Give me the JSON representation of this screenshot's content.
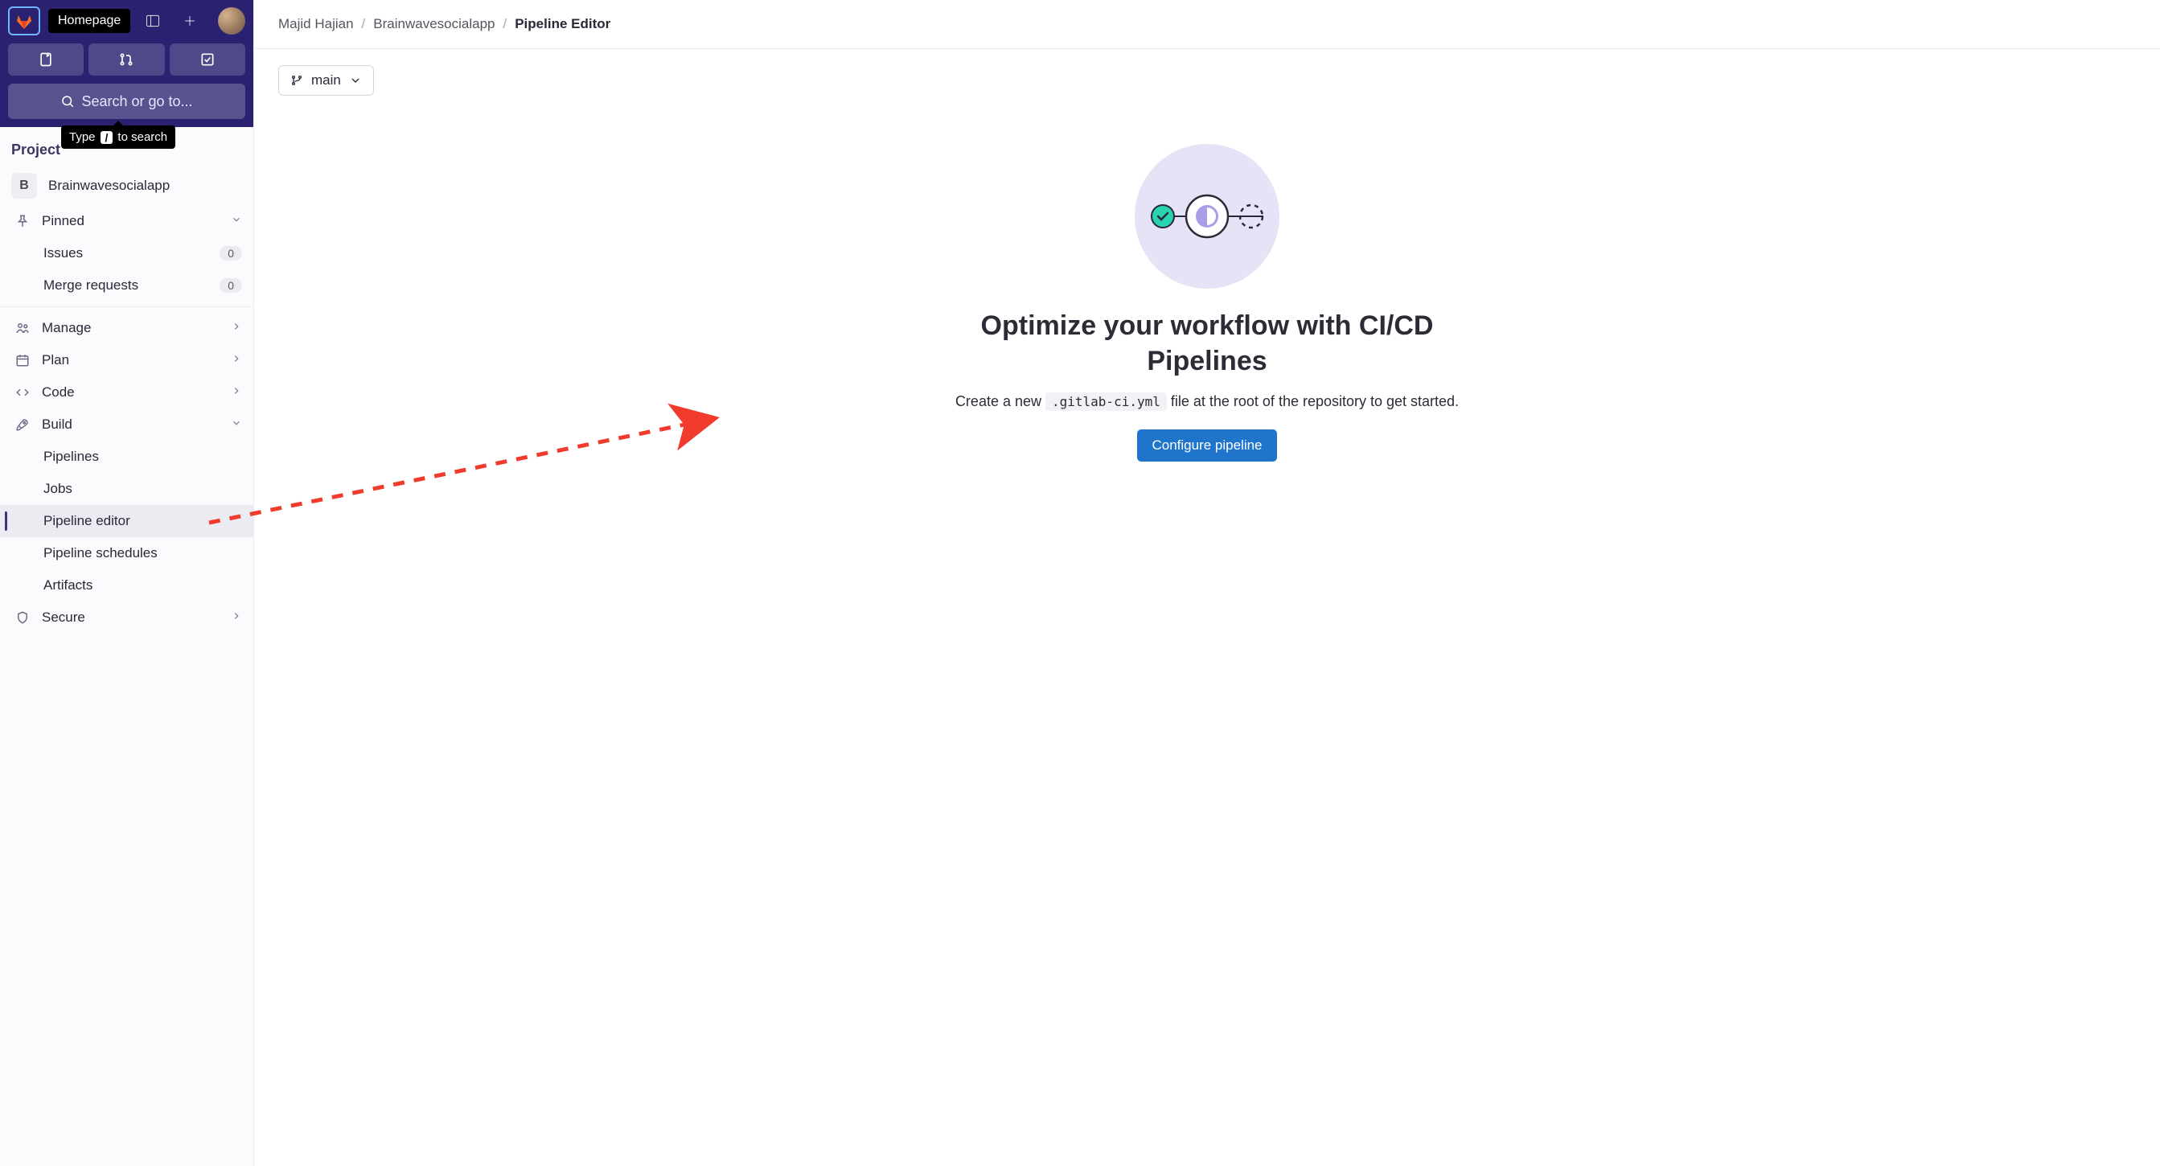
{
  "topbar": {
    "homepage_tooltip": "Homepage",
    "search_placeholder": "Search or go to...",
    "type_tooltip_pre": "Type",
    "type_tooltip_key": "/",
    "type_tooltip_post": "to search"
  },
  "sidebar": {
    "section_label": "Project",
    "project_initial": "B",
    "project_name": "Brainwavesocialapp",
    "pinned_label": "Pinned",
    "pinned_items": [
      {
        "label": "Issues",
        "count": "0"
      },
      {
        "label": "Merge requests",
        "count": "0"
      }
    ],
    "nav": {
      "manage": "Manage",
      "plan": "Plan",
      "code": "Code",
      "build": "Build",
      "secure": "Secure"
    },
    "build_items": [
      "Pipelines",
      "Jobs",
      "Pipeline editor",
      "Pipeline schedules",
      "Artifacts"
    ]
  },
  "breadcrumbs": {
    "a": "Majid Hajian",
    "b": "Brainwavesocialapp",
    "c": "Pipeline Editor"
  },
  "branch": {
    "label": "main"
  },
  "empty": {
    "title": "Optimize your workflow with CI/CD Pipelines",
    "desc_pre": "Create a new ",
    "desc_code": ".gitlab-ci.yml",
    "desc_post": " file at the root of the repository to get started.",
    "button": "Configure pipeline"
  }
}
